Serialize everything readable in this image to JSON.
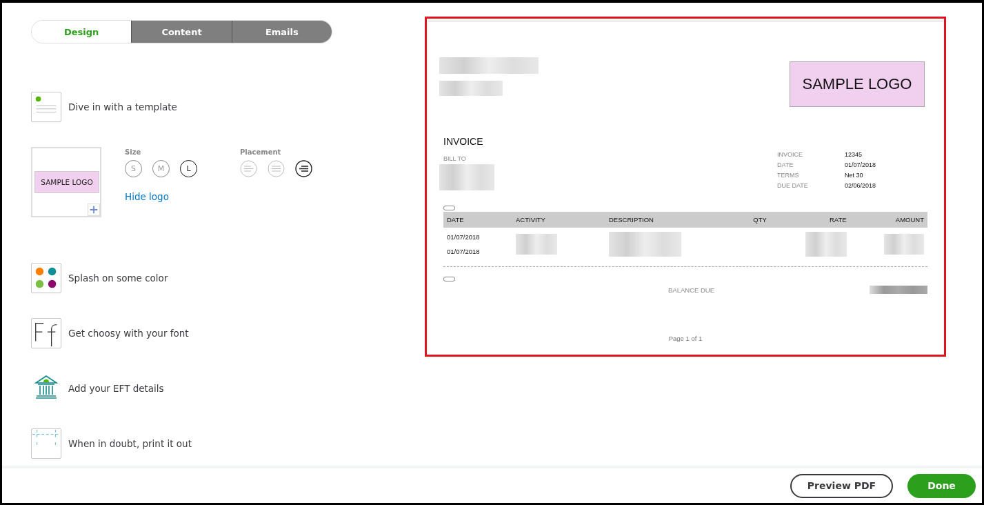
{
  "tabs": [
    {
      "label": "Design",
      "selected": true
    },
    {
      "label": "Content",
      "selected": false
    },
    {
      "label": "Emails",
      "selected": false
    }
  ],
  "steps": [
    {
      "kind": "template",
      "label": "Dive in with a template"
    },
    {
      "kind": "logo",
      "logo_text": "SAMPLE LOGO",
      "size_label": "Size",
      "sizes": [
        {
          "label": "S",
          "selected": false
        },
        {
          "label": "M",
          "selected": false
        },
        {
          "label": "L",
          "selected": true
        }
      ],
      "placement_label": "Placement",
      "placements": [
        {
          "kind": "left",
          "selected": false
        },
        {
          "kind": "center",
          "selected": false
        },
        {
          "kind": "right",
          "selected": true
        }
      ],
      "link": "Hide logo"
    },
    {
      "kind": "color",
      "label": "Splash on some color"
    },
    {
      "kind": "font",
      "label": "Get choosy with your font"
    },
    {
      "kind": "bank",
      "label": "Add your EFT details"
    },
    {
      "kind": "print",
      "label": "When in doubt, print it out"
    }
  ],
  "invoice": {
    "logo_text": "SAMPLE LOGO",
    "title": "INVOICE",
    "bill_to": "BILL TO",
    "meta": [
      {
        "label": "INVOICE",
        "value": "12345"
      },
      {
        "label": "DATE",
        "value": "01/07/2018"
      },
      {
        "label": "TERMS",
        "value": "Net 30"
      },
      {
        "label": "DUE DATE",
        "value": "02/06/2018"
      }
    ],
    "columns": [
      "DATE",
      "ACTIVITY",
      "DESCRIPTION",
      "QTY",
      "RATE",
      "AMOUNT"
    ],
    "rows": [
      {
        "date": "01/07/2018"
      },
      {
        "date": "01/07/2018"
      }
    ],
    "balance_label": "BALANCE DUE",
    "page": "Page 1 of 1"
  },
  "footer": {
    "preview": "Preview PDF",
    "done": "Done"
  }
}
